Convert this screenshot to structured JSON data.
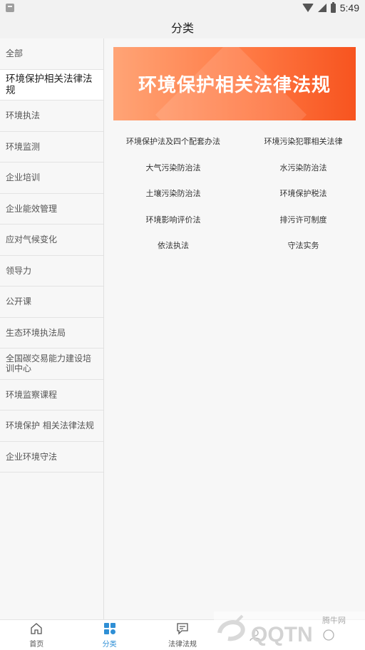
{
  "status_bar": {
    "time": "5:49"
  },
  "header": {
    "title": "分类"
  },
  "sidebar": {
    "items": [
      {
        "label": "全部"
      },
      {
        "label": "环境保护相关法律法规"
      },
      {
        "label": "环境执法"
      },
      {
        "label": "环境监测"
      },
      {
        "label": "企业培训"
      },
      {
        "label": "企业能效管理"
      },
      {
        "label": "应对气候变化"
      },
      {
        "label": "领导力"
      },
      {
        "label": "公开课"
      },
      {
        "label": "生态环境执法局"
      },
      {
        "label": "全国碳交易能力建设培训中心"
      },
      {
        "label": "环境监察课程"
      },
      {
        "label": "环境保护 相关法律法规"
      },
      {
        "label": "企业环境守法"
      }
    ]
  },
  "banner": {
    "title": "环境保护相关法律法规"
  },
  "links": [
    "环境保护法及四个配套办法",
    "环境污染犯罪相关法律",
    "大气污染防治法",
    "水污染防治法",
    "土壤污染防治法",
    "环境保护税法",
    "环境影响评价法",
    "排污许可制度",
    "依法执法",
    "守法实务"
  ],
  "tabbar": {
    "home": "首页",
    "category": "分类",
    "law": "法律法规",
    "accent_color": "#2f8fd5"
  },
  "watermark": {
    "cn": "腾牛网",
    "en": "QQTN"
  }
}
